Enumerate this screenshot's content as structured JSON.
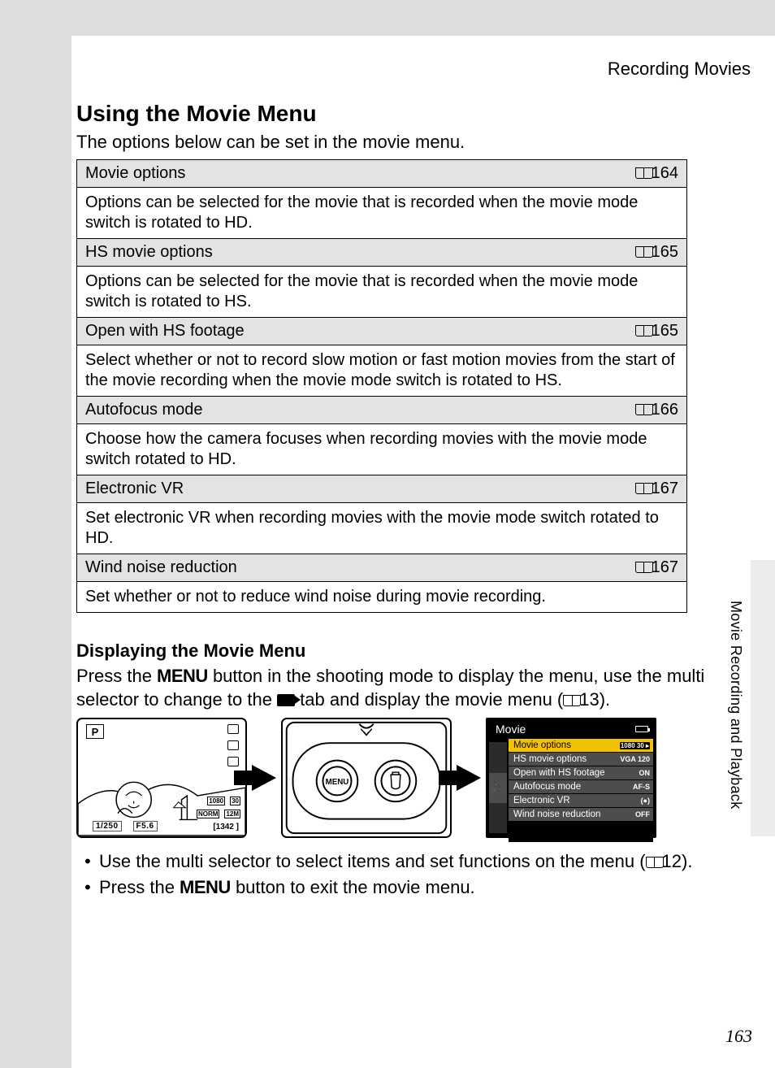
{
  "chapter_header": "Recording Movies",
  "title": "Using the Movie Menu",
  "intro": "The options below can be set in the movie menu.",
  "menu_items": [
    {
      "name": "Movie options",
      "page": "164",
      "desc": "Options can be selected for the movie that is recorded when the movie mode switch is rotated to HD."
    },
    {
      "name": "HS movie options",
      "page": "165",
      "desc": "Options can be selected for the movie that is recorded when the movie mode switch is rotated to HS."
    },
    {
      "name": "Open with HS footage",
      "page": "165",
      "desc": "Select whether or not to record slow motion or fast motion movies from the start of the movie recording when the movie mode switch is rotated to HS."
    },
    {
      "name": "Autofocus mode",
      "page": "166",
      "desc": "Choose how the camera focuses when recording movies with the movie mode switch rotated to HD."
    },
    {
      "name": "Electronic VR",
      "page": "167",
      "desc": "Set electronic VR when recording movies with the movie mode switch rotated to HD."
    },
    {
      "name": "Wind noise reduction",
      "page": "167",
      "desc": "Set whether or not to reduce wind noise during movie recording."
    }
  ],
  "subheading": "Displaying the Movie Menu",
  "para_parts": {
    "p1a": "Press the ",
    "menu_word1": "MENU",
    "p1b": " button in the shooting mode to display the menu, use the multi selector to change to the ",
    "p1c": " tab and display the movie menu (",
    "ref1": "13",
    "p1d": ")."
  },
  "lcd1": {
    "mode_badge": "P",
    "shutter": "1/250",
    "aperture": "F5.6",
    "counter": "[1342 ]",
    "row1a": "1080",
    "row1b": "30",
    "row2a": "NORM",
    "row2b": "12M"
  },
  "lcd2": {
    "btn1": "MENU",
    "btn2_icon": "trash"
  },
  "lcd3": {
    "title": "Movie",
    "rows": [
      {
        "label": "Movie options",
        "val": "1080 30 ▸"
      },
      {
        "label": "HS movie options",
        "val": "VGA 120"
      },
      {
        "label": "Open with HS footage",
        "val": "ON"
      },
      {
        "label": "Autofocus mode",
        "val": "AF-S"
      },
      {
        "label": "Electronic VR",
        "val": "(●)"
      },
      {
        "label": "Wind noise reduction",
        "val": "OFF"
      }
    ]
  },
  "bullets": {
    "b1a": "Use the multi selector to select items and set functions on the menu (",
    "b1ref": "12",
    "b1b": ").",
    "b2a": "Press the ",
    "b2menu": "MENU",
    "b2b": " button to exit the movie menu."
  },
  "side_label": "Movie Recording and Playback",
  "page_number": "163"
}
